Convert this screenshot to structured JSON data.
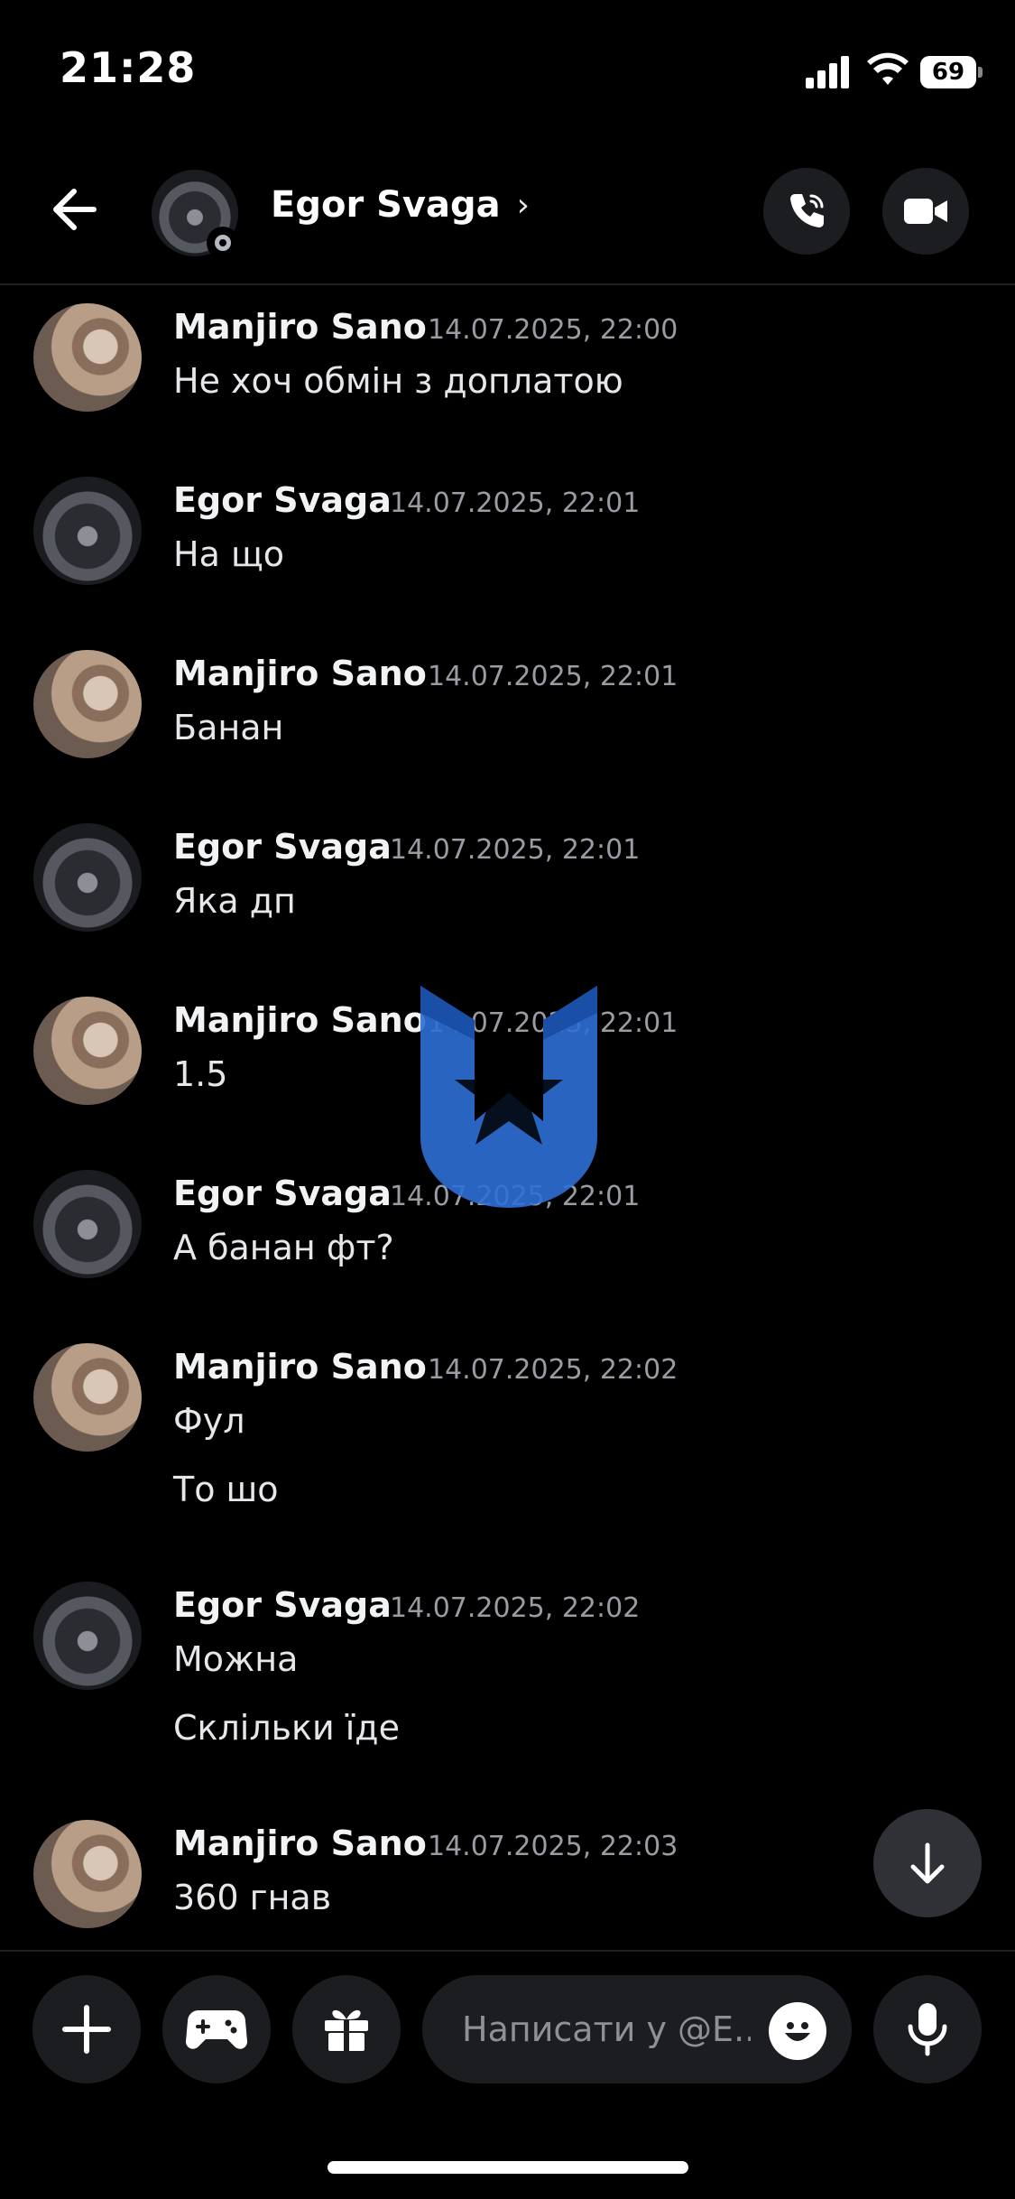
{
  "status_bar": {
    "time": "21:28",
    "battery": "69"
  },
  "header": {
    "contact_name": "Egor Svaga",
    "chevron": "›"
  },
  "messages": [
    {
      "author": "Manjiro Sano",
      "timestamp": "14.07.2025, 22:00",
      "lines": [
        "Не хоч обмін з доплатою"
      ]
    },
    {
      "author": "Egor Svaga",
      "timestamp": "14.07.2025, 22:01",
      "lines": [
        "На що"
      ]
    },
    {
      "author": "Manjiro Sano",
      "timestamp": "14.07.2025, 22:01",
      "lines": [
        "Банан"
      ]
    },
    {
      "author": "Egor Svaga",
      "timestamp": "14.07.2025, 22:01",
      "lines": [
        "Яка дп"
      ]
    },
    {
      "author": "Manjiro Sano",
      "timestamp": "14.07.2025, 22:01",
      "lines": [
        "1.5"
      ]
    },
    {
      "author": "Egor Svaga",
      "timestamp": "14.07.2025, 22:01",
      "lines": [
        "А банан фт?"
      ]
    },
    {
      "author": "Manjiro Sano",
      "timestamp": "14.07.2025, 22:02",
      "lines": [
        "Фул",
        "То шо"
      ]
    },
    {
      "author": "Egor Svaga",
      "timestamp": "14.07.2025, 22:02",
      "lines": [
        "Можна",
        "Склільки їде"
      ]
    },
    {
      "author": "Manjiro Sano",
      "timestamp": "14.07.2025, 22:03",
      "lines": [
        "360 гнав"
      ]
    }
  ],
  "composer": {
    "placeholder": "Написати у @E.."
  },
  "icons": {
    "back": "arrow-left-icon",
    "call": "phone-icon",
    "video": "video-camera-icon",
    "scroll_down": "arrow-down-icon",
    "plus": "plus-icon",
    "game": "gamepad-icon",
    "gift": "gift-icon",
    "emoji": "emoji-icon",
    "mic": "microphone-icon"
  },
  "colors": {
    "background": "#000000",
    "timestamp": "#9a9ca3",
    "button_bg": "#1c1d21",
    "watermark": "#2f6fd6"
  }
}
